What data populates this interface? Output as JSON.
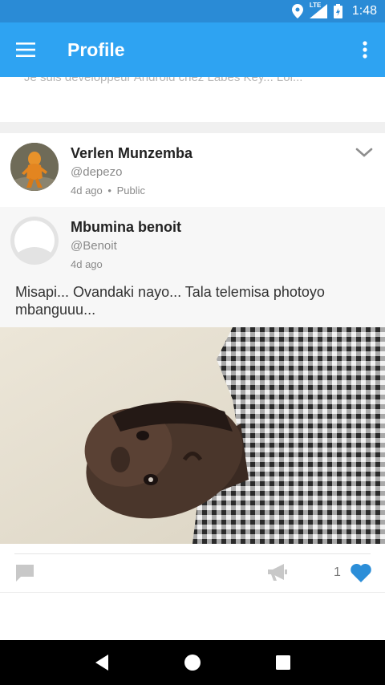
{
  "status_bar": {
    "time": "1:48",
    "network": "LTE",
    "icons": [
      "location-icon",
      "signal-icon",
      "battery-icon"
    ]
  },
  "app_bar": {
    "title": "Profile",
    "icons": [
      "menu-icon",
      "more-vert-icon"
    ]
  },
  "profile": {
    "bio": "Je suis développeur Android chez Labes Key... Loi..."
  },
  "post": {
    "author": {
      "name": "Verlen Munzemba",
      "handle": "@depezo",
      "time": "4d ago",
      "separator": "•",
      "visibility": "Public"
    },
    "shared": {
      "name": "Mbumina benoit",
      "handle": "@Benoit",
      "time": "4d ago",
      "text": "Misapi... Ovandaki nayo... Tala telemisa photoyo mbanguuu..."
    },
    "actions": {
      "like_count": "1"
    }
  },
  "colors": {
    "status_bar": "#2a8bd6",
    "app_bar": "#2ea3f2",
    "like": "#2c8ed8"
  }
}
